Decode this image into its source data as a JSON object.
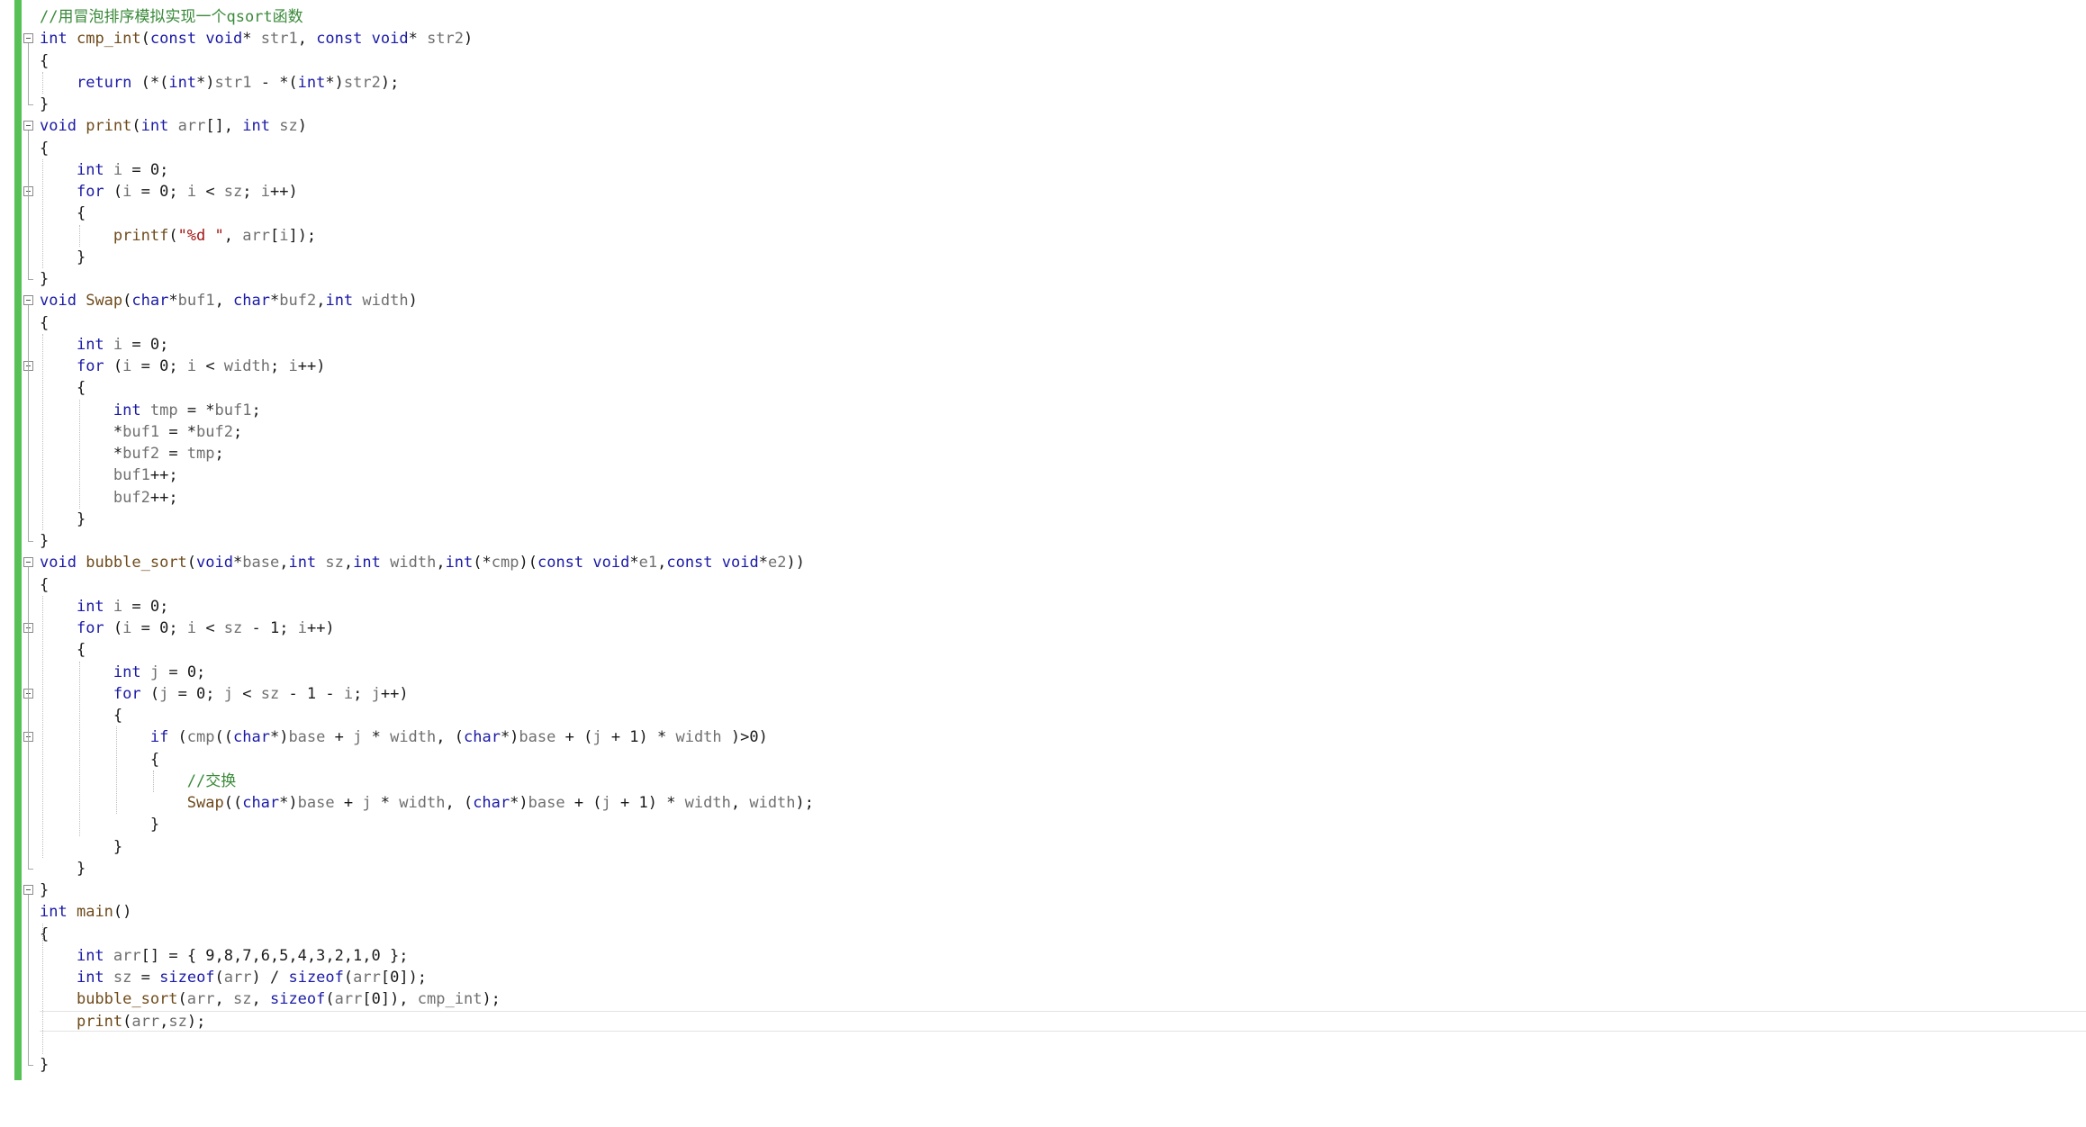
{
  "editor": {
    "lines": [
      [
        {
          "t": "//用冒泡排序模拟实现一个qsort函数",
          "c": "cm"
        }
      ],
      [
        {
          "t": "int",
          "c": "kw"
        },
        {
          "t": " ",
          "c": "pl"
        },
        {
          "t": "cmp_int",
          "c": "fn"
        },
        {
          "t": "(",
          "c": "pl"
        },
        {
          "t": "const",
          "c": "kw"
        },
        {
          "t": " ",
          "c": "pl"
        },
        {
          "t": "void",
          "c": "kw"
        },
        {
          "t": "* ",
          "c": "pl"
        },
        {
          "t": "str1",
          "c": "id"
        },
        {
          "t": ", ",
          "c": "pl"
        },
        {
          "t": "const",
          "c": "kw"
        },
        {
          "t": " ",
          "c": "pl"
        },
        {
          "t": "void",
          "c": "kw"
        },
        {
          "t": "* ",
          "c": "pl"
        },
        {
          "t": "str2",
          "c": "id"
        },
        {
          "t": ")",
          "c": "pl"
        }
      ],
      [
        {
          "t": "{",
          "c": "pl"
        }
      ],
      [
        {
          "t": "    ",
          "c": "pl"
        },
        {
          "t": "return",
          "c": "kw"
        },
        {
          "t": " (*(",
          "c": "pl"
        },
        {
          "t": "int",
          "c": "kw"
        },
        {
          "t": "*)",
          "c": "pl"
        },
        {
          "t": "str1",
          "c": "id"
        },
        {
          "t": " - *(",
          "c": "pl"
        },
        {
          "t": "int",
          "c": "kw"
        },
        {
          "t": "*)",
          "c": "pl"
        },
        {
          "t": "str2",
          "c": "id"
        },
        {
          "t": ");",
          "c": "pl"
        }
      ],
      [
        {
          "t": "}",
          "c": "pl"
        }
      ],
      [
        {
          "t": "void",
          "c": "kw"
        },
        {
          "t": " ",
          "c": "pl"
        },
        {
          "t": "print",
          "c": "fn"
        },
        {
          "t": "(",
          "c": "pl"
        },
        {
          "t": "int",
          "c": "kw"
        },
        {
          "t": " ",
          "c": "pl"
        },
        {
          "t": "arr",
          "c": "id"
        },
        {
          "t": "[], ",
          "c": "pl"
        },
        {
          "t": "int",
          "c": "kw"
        },
        {
          "t": " ",
          "c": "pl"
        },
        {
          "t": "sz",
          "c": "id"
        },
        {
          "t": ")",
          "c": "pl"
        }
      ],
      [
        {
          "t": "{",
          "c": "pl"
        }
      ],
      [
        {
          "t": "    ",
          "c": "pl"
        },
        {
          "t": "int",
          "c": "kw"
        },
        {
          "t": " ",
          "c": "pl"
        },
        {
          "t": "i",
          "c": "id"
        },
        {
          "t": " = 0;",
          "c": "pl"
        }
      ],
      [
        {
          "t": "    ",
          "c": "pl"
        },
        {
          "t": "for",
          "c": "kw"
        },
        {
          "t": " (",
          "c": "pl"
        },
        {
          "t": "i",
          "c": "id"
        },
        {
          "t": " = 0; ",
          "c": "pl"
        },
        {
          "t": "i",
          "c": "id"
        },
        {
          "t": " < ",
          "c": "pl"
        },
        {
          "t": "sz",
          "c": "id"
        },
        {
          "t": "; ",
          "c": "pl"
        },
        {
          "t": "i",
          "c": "id"
        },
        {
          "t": "++)",
          "c": "pl"
        }
      ],
      [
        {
          "t": "    {",
          "c": "pl"
        }
      ],
      [
        {
          "t": "        ",
          "c": "pl"
        },
        {
          "t": "printf",
          "c": "fn"
        },
        {
          "t": "(",
          "c": "pl"
        },
        {
          "t": "\"%d \"",
          "c": "str"
        },
        {
          "t": ", ",
          "c": "pl"
        },
        {
          "t": "arr",
          "c": "id"
        },
        {
          "t": "[",
          "c": "pl"
        },
        {
          "t": "i",
          "c": "id"
        },
        {
          "t": "]);",
          "c": "pl"
        }
      ],
      [
        {
          "t": "    }",
          "c": "pl"
        }
      ],
      [
        {
          "t": "}",
          "c": "pl"
        }
      ],
      [
        {
          "t": "void",
          "c": "kw"
        },
        {
          "t": " ",
          "c": "pl"
        },
        {
          "t": "Swap",
          "c": "fn"
        },
        {
          "t": "(",
          "c": "pl"
        },
        {
          "t": "char",
          "c": "kw"
        },
        {
          "t": "*",
          "c": "pl"
        },
        {
          "t": "buf1",
          "c": "id"
        },
        {
          "t": ", ",
          "c": "pl"
        },
        {
          "t": "char",
          "c": "kw"
        },
        {
          "t": "*",
          "c": "pl"
        },
        {
          "t": "buf2",
          "c": "id"
        },
        {
          "t": ",",
          "c": "pl"
        },
        {
          "t": "int",
          "c": "kw"
        },
        {
          "t": " ",
          "c": "pl"
        },
        {
          "t": "width",
          "c": "id"
        },
        {
          "t": ")",
          "c": "pl"
        }
      ],
      [
        {
          "t": "{",
          "c": "pl"
        }
      ],
      [
        {
          "t": "    ",
          "c": "pl"
        },
        {
          "t": "int",
          "c": "kw"
        },
        {
          "t": " ",
          "c": "pl"
        },
        {
          "t": "i",
          "c": "id"
        },
        {
          "t": " = 0;",
          "c": "pl"
        }
      ],
      [
        {
          "t": "    ",
          "c": "pl"
        },
        {
          "t": "for",
          "c": "kw"
        },
        {
          "t": " (",
          "c": "pl"
        },
        {
          "t": "i",
          "c": "id"
        },
        {
          "t": " = 0; ",
          "c": "pl"
        },
        {
          "t": "i",
          "c": "id"
        },
        {
          "t": " < ",
          "c": "pl"
        },
        {
          "t": "width",
          "c": "id"
        },
        {
          "t": "; ",
          "c": "pl"
        },
        {
          "t": "i",
          "c": "id"
        },
        {
          "t": "++)",
          "c": "pl"
        }
      ],
      [
        {
          "t": "    {",
          "c": "pl"
        }
      ],
      [
        {
          "t": "        ",
          "c": "pl"
        },
        {
          "t": "int",
          "c": "kw"
        },
        {
          "t": " ",
          "c": "pl"
        },
        {
          "t": "tmp",
          "c": "id"
        },
        {
          "t": " = *",
          "c": "pl"
        },
        {
          "t": "buf1",
          "c": "id"
        },
        {
          "t": ";",
          "c": "pl"
        }
      ],
      [
        {
          "t": "        *",
          "c": "pl"
        },
        {
          "t": "buf1",
          "c": "id"
        },
        {
          "t": " = *",
          "c": "pl"
        },
        {
          "t": "buf2",
          "c": "id"
        },
        {
          "t": ";",
          "c": "pl"
        }
      ],
      [
        {
          "t": "        *",
          "c": "pl"
        },
        {
          "t": "buf2",
          "c": "id"
        },
        {
          "t": " = ",
          "c": "pl"
        },
        {
          "t": "tmp",
          "c": "id"
        },
        {
          "t": ";",
          "c": "pl"
        }
      ],
      [
        {
          "t": "        ",
          "c": "pl"
        },
        {
          "t": "buf1",
          "c": "id"
        },
        {
          "t": "++;",
          "c": "pl"
        }
      ],
      [
        {
          "t": "        ",
          "c": "pl"
        },
        {
          "t": "buf2",
          "c": "id"
        },
        {
          "t": "++;",
          "c": "pl"
        }
      ],
      [
        {
          "t": "    }",
          "c": "pl"
        }
      ],
      [
        {
          "t": "}",
          "c": "pl"
        }
      ],
      [
        {
          "t": "void",
          "c": "kw"
        },
        {
          "t": " ",
          "c": "pl"
        },
        {
          "t": "bubble_sort",
          "c": "fn"
        },
        {
          "t": "(",
          "c": "pl"
        },
        {
          "t": "void",
          "c": "kw"
        },
        {
          "t": "*",
          "c": "pl"
        },
        {
          "t": "base",
          "c": "id"
        },
        {
          "t": ",",
          "c": "pl"
        },
        {
          "t": "int",
          "c": "kw"
        },
        {
          "t": " ",
          "c": "pl"
        },
        {
          "t": "sz",
          "c": "id"
        },
        {
          "t": ",",
          "c": "pl"
        },
        {
          "t": "int",
          "c": "kw"
        },
        {
          "t": " ",
          "c": "pl"
        },
        {
          "t": "width",
          "c": "id"
        },
        {
          "t": ",",
          "c": "pl"
        },
        {
          "t": "int",
          "c": "kw"
        },
        {
          "t": "(*",
          "c": "pl"
        },
        {
          "t": "cmp",
          "c": "id"
        },
        {
          "t": ")(",
          "c": "pl"
        },
        {
          "t": "const",
          "c": "kw"
        },
        {
          "t": " ",
          "c": "pl"
        },
        {
          "t": "void",
          "c": "kw"
        },
        {
          "t": "*",
          "c": "pl"
        },
        {
          "t": "e1",
          "c": "id"
        },
        {
          "t": ",",
          "c": "pl"
        },
        {
          "t": "const",
          "c": "kw"
        },
        {
          "t": " ",
          "c": "pl"
        },
        {
          "t": "void",
          "c": "kw"
        },
        {
          "t": "*",
          "c": "pl"
        },
        {
          "t": "e2",
          "c": "id"
        },
        {
          "t": "))",
          "c": "pl"
        }
      ],
      [
        {
          "t": "{",
          "c": "pl"
        }
      ],
      [
        {
          "t": "    ",
          "c": "pl"
        },
        {
          "t": "int",
          "c": "kw"
        },
        {
          "t": " ",
          "c": "pl"
        },
        {
          "t": "i",
          "c": "id"
        },
        {
          "t": " = 0;",
          "c": "pl"
        }
      ],
      [
        {
          "t": "    ",
          "c": "pl"
        },
        {
          "t": "for",
          "c": "kw"
        },
        {
          "t": " (",
          "c": "pl"
        },
        {
          "t": "i",
          "c": "id"
        },
        {
          "t": " = 0; ",
          "c": "pl"
        },
        {
          "t": "i",
          "c": "id"
        },
        {
          "t": " < ",
          "c": "pl"
        },
        {
          "t": "sz",
          "c": "id"
        },
        {
          "t": " - 1; ",
          "c": "pl"
        },
        {
          "t": "i",
          "c": "id"
        },
        {
          "t": "++)",
          "c": "pl"
        }
      ],
      [
        {
          "t": "    {",
          "c": "pl"
        }
      ],
      [
        {
          "t": "        ",
          "c": "pl"
        },
        {
          "t": "int",
          "c": "kw"
        },
        {
          "t": " ",
          "c": "pl"
        },
        {
          "t": "j",
          "c": "id"
        },
        {
          "t": " = 0;",
          "c": "pl"
        }
      ],
      [
        {
          "t": "        ",
          "c": "pl"
        },
        {
          "t": "for",
          "c": "kw"
        },
        {
          "t": " (",
          "c": "pl"
        },
        {
          "t": "j",
          "c": "id"
        },
        {
          "t": " = 0; ",
          "c": "pl"
        },
        {
          "t": "j",
          "c": "id"
        },
        {
          "t": " < ",
          "c": "pl"
        },
        {
          "t": "sz",
          "c": "id"
        },
        {
          "t": " - 1 - ",
          "c": "pl"
        },
        {
          "t": "i",
          "c": "id"
        },
        {
          "t": "; ",
          "c": "pl"
        },
        {
          "t": "j",
          "c": "id"
        },
        {
          "t": "++)",
          "c": "pl"
        }
      ],
      [
        {
          "t": "        {",
          "c": "pl"
        }
      ],
      [
        {
          "t": "            ",
          "c": "pl"
        },
        {
          "t": "if",
          "c": "kw"
        },
        {
          "t": " (",
          "c": "pl"
        },
        {
          "t": "cmp",
          "c": "id"
        },
        {
          "t": "((",
          "c": "pl"
        },
        {
          "t": "char",
          "c": "kw"
        },
        {
          "t": "*)",
          "c": "pl"
        },
        {
          "t": "base",
          "c": "id"
        },
        {
          "t": " + ",
          "c": "pl"
        },
        {
          "t": "j",
          "c": "id"
        },
        {
          "t": " * ",
          "c": "pl"
        },
        {
          "t": "width",
          "c": "id"
        },
        {
          "t": ", (",
          "c": "pl"
        },
        {
          "t": "char",
          "c": "kw"
        },
        {
          "t": "*)",
          "c": "pl"
        },
        {
          "t": "base",
          "c": "id"
        },
        {
          "t": " + (",
          "c": "pl"
        },
        {
          "t": "j",
          "c": "id"
        },
        {
          "t": " + 1) * ",
          "c": "pl"
        },
        {
          "t": "width",
          "c": "id"
        },
        {
          "t": " )>0)",
          "c": "pl"
        }
      ],
      [
        {
          "t": "            {",
          "c": "pl"
        }
      ],
      [
        {
          "t": "                ",
          "c": "pl"
        },
        {
          "t": "//交换",
          "c": "cm"
        }
      ],
      [
        {
          "t": "                ",
          "c": "pl"
        },
        {
          "t": "Swap",
          "c": "fn"
        },
        {
          "t": "((",
          "c": "pl"
        },
        {
          "t": "char",
          "c": "kw"
        },
        {
          "t": "*)",
          "c": "pl"
        },
        {
          "t": "base",
          "c": "id"
        },
        {
          "t": " + ",
          "c": "pl"
        },
        {
          "t": "j",
          "c": "id"
        },
        {
          "t": " * ",
          "c": "pl"
        },
        {
          "t": "width",
          "c": "id"
        },
        {
          "t": ", (",
          "c": "pl"
        },
        {
          "t": "char",
          "c": "kw"
        },
        {
          "t": "*)",
          "c": "pl"
        },
        {
          "t": "base",
          "c": "id"
        },
        {
          "t": " + (",
          "c": "pl"
        },
        {
          "t": "j",
          "c": "id"
        },
        {
          "t": " + 1) * ",
          "c": "pl"
        },
        {
          "t": "width",
          "c": "id"
        },
        {
          "t": ", ",
          "c": "pl"
        },
        {
          "t": "width",
          "c": "id"
        },
        {
          "t": ");",
          "c": "pl"
        }
      ],
      [
        {
          "t": "            }",
          "c": "pl"
        }
      ],
      [
        {
          "t": "        }",
          "c": "pl"
        }
      ],
      [
        {
          "t": "    }",
          "c": "pl"
        }
      ],
      [
        {
          "t": "}",
          "c": "pl"
        }
      ],
      [
        {
          "t": "int",
          "c": "kw"
        },
        {
          "t": " ",
          "c": "pl"
        },
        {
          "t": "main",
          "c": "fn"
        },
        {
          "t": "()",
          "c": "pl"
        }
      ],
      [
        {
          "t": "{",
          "c": "pl"
        }
      ],
      [
        {
          "t": "    ",
          "c": "pl"
        },
        {
          "t": "int",
          "c": "kw"
        },
        {
          "t": " ",
          "c": "pl"
        },
        {
          "t": "arr",
          "c": "id"
        },
        {
          "t": "[] = { 9,8,7,6,5,4,3,2,1,0 };",
          "c": "pl"
        }
      ],
      [
        {
          "t": "    ",
          "c": "pl"
        },
        {
          "t": "int",
          "c": "kw"
        },
        {
          "t": " ",
          "c": "pl"
        },
        {
          "t": "sz",
          "c": "id"
        },
        {
          "t": " = ",
          "c": "pl"
        },
        {
          "t": "sizeof",
          "c": "kw"
        },
        {
          "t": "(",
          "c": "pl"
        },
        {
          "t": "arr",
          "c": "id"
        },
        {
          "t": ") / ",
          "c": "pl"
        },
        {
          "t": "sizeof",
          "c": "kw"
        },
        {
          "t": "(",
          "c": "pl"
        },
        {
          "t": "arr",
          "c": "id"
        },
        {
          "t": "[0]);",
          "c": "pl"
        }
      ],
      [
        {
          "t": "    ",
          "c": "pl"
        },
        {
          "t": "bubble_sort",
          "c": "fn"
        },
        {
          "t": "(",
          "c": "pl"
        },
        {
          "t": "arr",
          "c": "id"
        },
        {
          "t": ", ",
          "c": "pl"
        },
        {
          "t": "sz",
          "c": "id"
        },
        {
          "t": ", ",
          "c": "pl"
        },
        {
          "t": "sizeof",
          "c": "kw"
        },
        {
          "t": "(",
          "c": "pl"
        },
        {
          "t": "arr",
          "c": "id"
        },
        {
          "t": "[0]), ",
          "c": "pl"
        },
        {
          "t": "cmp_int",
          "c": "id"
        },
        {
          "t": ");",
          "c": "pl"
        }
      ],
      [
        {
          "t": "    ",
          "c": "pl"
        },
        {
          "t": "print",
          "c": "fn"
        },
        {
          "t": "(",
          "c": "pl"
        },
        {
          "t": "arr",
          "c": "id"
        },
        {
          "t": ",",
          "c": "pl"
        },
        {
          "t": "sz",
          "c": "id"
        },
        {
          "t": ");",
          "c": "pl"
        }
      ],
      [
        {
          "t": "",
          "c": "pl"
        }
      ],
      [
        {
          "t": "}",
          "c": "pl"
        }
      ]
    ],
    "current_line": 46,
    "fold_points": [
      1,
      5,
      8,
      13,
      16,
      25,
      28,
      31,
      33,
      40
    ]
  },
  "colors": {
    "kw": "#1a1aa6",
    "cm": "#3a8a3a",
    "str": "#a31515",
    "id": "#6f6f6f",
    "fn": "#6f4b1b",
    "pl": "#1a1a1a",
    "change_bar": "#57c157"
  }
}
